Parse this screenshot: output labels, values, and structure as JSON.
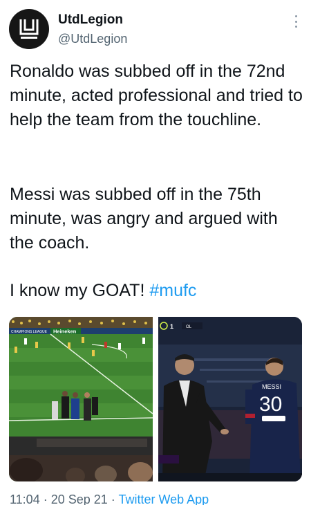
{
  "account": {
    "display_name": "UtdLegion",
    "handle": "@UtdLegion",
    "avatar_letter": "U"
  },
  "tweet": {
    "paragraph1": "Ronaldo was subbed off in the 72nd minute, acted professional and tried to help the team from the touchline.",
    "paragraph2": "Messi was subbed off in the 75th minute, was angry and argued with the coach.",
    "paragraph3_text": "I know my GOAT! ",
    "hashtag": "#mufc"
  },
  "media": {
    "left": {
      "board_text_1": "CHAMPIONS LEAGUE",
      "board_text_2": "Heineken"
    },
    "right": {
      "shirt_name": "MESSI",
      "shirt_number": "30",
      "score_digit": "1"
    }
  },
  "footer": {
    "time": "11:04",
    "sep1": " · ",
    "date": "20 Sep 21",
    "sep2": " · ",
    "app": "Twitter Web App"
  },
  "colors": {
    "link": "#1d9bf0",
    "secondary_text": "#536471",
    "pitch": "#3c7d2f"
  }
}
